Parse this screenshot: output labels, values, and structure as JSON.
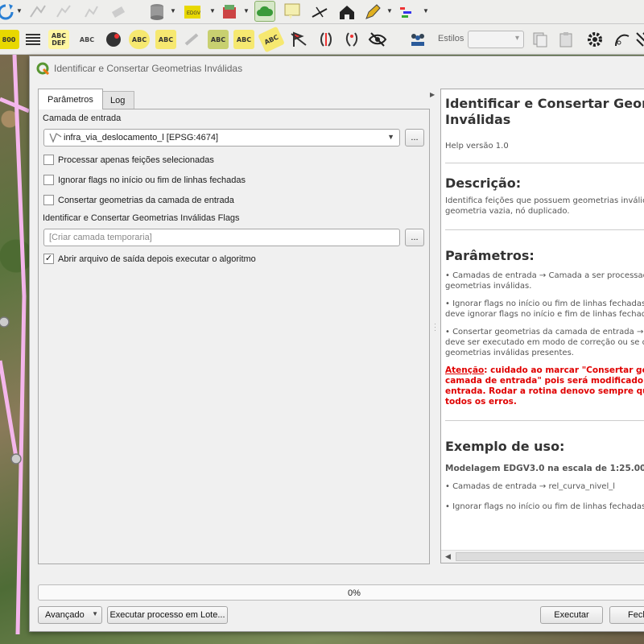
{
  "toolbar2": {
    "styles_label": "Estilos",
    "scale_icon_text": "800",
    "abc_labels": [
      "ABC",
      "ABC\nDEF",
      "ABC",
      "ABC",
      "ABC",
      "ABC",
      "ABC",
      "ABC"
    ]
  },
  "dialog": {
    "title": "Identificar e Consertar Geometrias Inválidas",
    "tabs": [
      "Parâmetros",
      "Log"
    ],
    "input_layer_label": "Camada de entrada",
    "input_layer_value": "infra_via_deslocamento_l [EPSG:4674]",
    "checkbox_selected_only": "Processar apenas feições selecionadas",
    "checkbox_ignore_flags": "Ignorar flags no início ou fim de linhas fechadas",
    "checkbox_fix_input": "Consertar geometrias da camada de entrada",
    "flags_label": "Identificar e Consertar Geometrias Inválidas Flags",
    "flags_placeholder": "[Criar camada temporaria]",
    "checkbox_open_output": "Abrir arquivo de saída depois executar o algoritmo",
    "ellipsis": "...",
    "checked": {
      "selected_only": false,
      "ignore_flags": false,
      "fix_input": false,
      "open_output": true
    }
  },
  "help": {
    "title_line1": "Identificar e Consertar Geom",
    "title_line2": "Inválidas",
    "version": "Help versão 1.0",
    "description_heading": "Descrição:",
    "description_line1": "Identifica feições que possuem geometrias inválidas",
    "description_line2": "geometria vazia, nó duplicado.",
    "params_heading": "Parâmetros:",
    "param1_line1": "• Camadas de entrada → Camada a ser processada",
    "param1_line2": "geometrias inválidas.",
    "param2_line1": "• Ignorar flags no início ou fim de linhas fechadas →",
    "param2_line2": "deve ignorar flags no início e fim de linhas fechadas.",
    "param3_line1": "• Consertar geometrias da camada de entrada → In",
    "param3_line2": "deve ser executado em modo de correção ou se dev",
    "param3_line3": "geometrias inválidas presentes.",
    "warning_word": "Atenção",
    "warning_line1": ": cuidado ao marcar \"Consertar geo",
    "warning_line2": "camada de entrada\" pois será modificado a",
    "warning_line3": "entrada. Rodar a rotina denovo sempre que",
    "warning_line4": "todos os erros.",
    "example_heading": "Exemplo de uso:",
    "example_subtitle": "Modelagem EDGV3.0 na escala de 1:25.000 (",
    "example_item1": "• Camadas de entrada → rel_curva_nivel_l",
    "example_item2": "• Ignorar flags no início ou fim de linhas fechadas →"
  },
  "footer": {
    "progress_text": "0%",
    "progress_value": 0,
    "advanced_label": "Avançado",
    "batch_label": "Executar processo em Lote...",
    "run_label": "Executar",
    "close_label": "Fech"
  },
  "colors": {
    "warning": "#e00000",
    "qgis_green": "#589632"
  }
}
